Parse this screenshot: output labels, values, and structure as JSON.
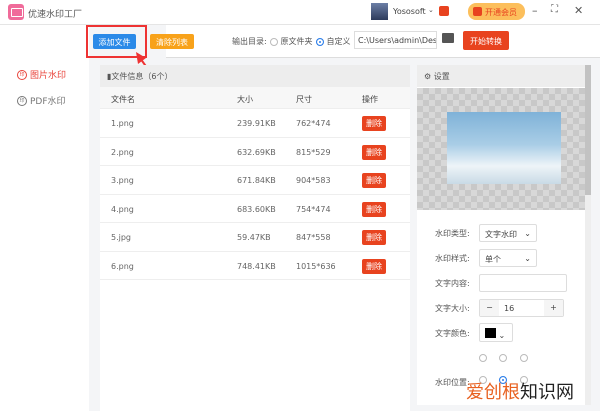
{
  "app": {
    "title": "优速水印工厂",
    "user": "Yososoft",
    "vip": "开通会员"
  },
  "toolbar": {
    "add": "添加文件",
    "clear": "清除列表",
    "output_label": "输出目录:",
    "opt_original": "原文件夹",
    "opt_custom": "自定义",
    "path": "C:\\Users\\admin\\Deskto",
    "start": "开始转换"
  },
  "sidebar": {
    "items": [
      {
        "label": "图片水印",
        "active": true
      },
      {
        "label": "PDF水印",
        "active": false
      }
    ]
  },
  "files": {
    "title": "文件信息（6个）",
    "headers": [
      "文件名",
      "大小",
      "尺寸",
      "操作"
    ],
    "delete": "删除",
    "rows": [
      {
        "name": "1.png",
        "size": "239.91KB",
        "dim": "762*474"
      },
      {
        "name": "2.png",
        "size": "632.69KB",
        "dim": "815*529"
      },
      {
        "name": "3.png",
        "size": "671.84KB",
        "dim": "904*583"
      },
      {
        "name": "4.png",
        "size": "683.60KB",
        "dim": "754*474"
      },
      {
        "name": "5.jpg",
        "size": "59.47KB",
        "dim": "847*558"
      },
      {
        "name": "6.png",
        "size": "748.41KB",
        "dim": "1015*636"
      }
    ]
  },
  "settings": {
    "title": "设置",
    "type_label": "水印类型:",
    "type_value": "文字水印",
    "style_label": "水印样式:",
    "style_value": "单个",
    "content_label": "文字内容:",
    "content_value": "",
    "size_label": "文字大小:",
    "size_value": "16",
    "color_label": "文字颜色:",
    "color": "#000000",
    "position_label": "水印位置:"
  },
  "watermark": {
    "a": "爱创根",
    "b": "知识网"
  }
}
